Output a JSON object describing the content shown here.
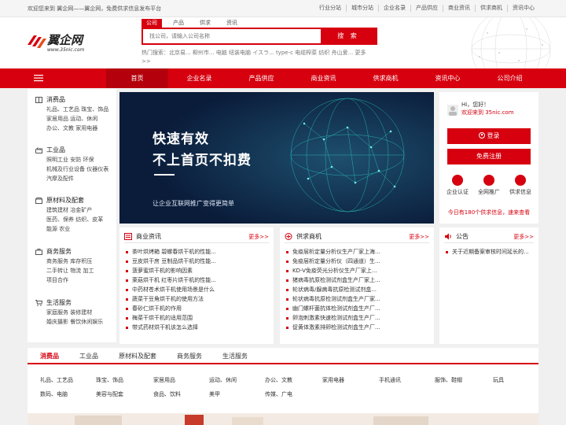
{
  "topbar": {
    "welcome": "欢迎您来到 翼企网——翼企网，免费供求信息发布平台",
    "links": [
      "行业分站",
      "城市分站",
      "企业名录",
      "产品供应",
      "商业资讯",
      "供求商机",
      "资讯中心"
    ]
  },
  "logo": {
    "name": "翼企网",
    "url": "www.35nic.com"
  },
  "search": {
    "tabs": [
      "公司",
      "产品",
      "供求",
      "资讯"
    ],
    "placeholder": "找公司，请输入公司名称",
    "button": "搜 索",
    "hot_label": "热门搜索：",
    "hot_text": "北京易...   柳州市...   电脑  纽装电脑  イスラ...   type-c 电缆榨菜  纺织  舟山爱...",
    "more": "更多>>"
  },
  "nav": {
    "menu_icon": "hamburger-icon",
    "items": [
      "首页",
      "企业名录",
      "产品供应",
      "商业资讯",
      "供求商机",
      "资讯中心",
      "公司介绍"
    ]
  },
  "categories": [
    {
      "title": "消费品",
      "icon": "book-icon",
      "lines": [
        "礼品、工艺品  珠宝、饰品",
        "家居用品  运动、休闲",
        "办公、文教  家用电器"
      ]
    },
    {
      "title": "工业品",
      "icon": "factory-icon",
      "lines": [
        "照明工业  安防  环保",
        "机械及行业设备  仪器仪表",
        "汽摩及配件"
      ]
    },
    {
      "title": "原材料及配套",
      "icon": "box-icon",
      "lines": [
        "建筑建材  冶金矿产",
        "医药、保养  纺织、皮革",
        "能源  农业"
      ]
    },
    {
      "title": "商务服务",
      "icon": "briefcase-icon",
      "lines": [
        "商务服务  库存积压",
        "二手转让  物流  加工",
        "项目合作"
      ]
    },
    {
      "title": "生活服务",
      "icon": "cart-icon",
      "lines": [
        "家庭服务  装修建材",
        "婚庆摄影  餐饮休闲娱乐"
      ]
    }
  ],
  "banner": {
    "line1": "快速有效",
    "line2": "不上首页不扣费",
    "line3": "让企业互联网推广变得更简单"
  },
  "user": {
    "greeting": "Hi，您好！",
    "welcome": "欢迎来到 35nic.com",
    "login": "登录",
    "register": "免费注册",
    "icons": [
      {
        "label": "企业认证",
        "icon": "certify-icon"
      },
      {
        "label": "全网推广",
        "icon": "promote-icon"
      },
      {
        "label": "供求信息",
        "icon": "info-icon"
      }
    ],
    "tip": "今日有180个供求信息，速来查看"
  },
  "news": {
    "title": "商业资讯",
    "more": "更多>>",
    "items": [
      "茶叶烘烤箱 碧螺春烘干机的性能...",
      "豆皮烘干房 豆制品烘干机的性能...",
      "菠萝蜜烘干机的影响因素",
      "萊菇烘干机 红枣片烘干机的性能...",
      "中药材苍术烘干机使用场景是什么",
      "蔬菜干豆角烘干机的使用方法",
      "春砂仁烘干机的作用",
      "梅菜干烘干机的适用范围",
      "带式药材烘干机该怎么选择"
    ]
  },
  "supply": {
    "title": "供求商机",
    "more": "更多>>",
    "items": [
      "免疫层析定量分析仪生产厂家上海...",
      "免疫层析定量分析仪（四通道）生...",
      "KD-V免疫荧光分析仪生产厂家上...",
      "猪病毒抗原检测试剂盒生产厂家上...",
      "轮状病毒/腺病毒抗原检测试剂盒...",
      "轮状病毒抗原检测试剂盒生产厂家...",
      "幽门螺杆菌抗体检测试剂盒生产厂...",
      "卵泡刺激素快速检测试剂盒生产厂...",
      "促黄体激素排卵检测试剂盒生产厂..."
    ]
  },
  "notice": {
    "title": "公告",
    "more": "更多>>",
    "items": [
      "关于近期备案审核时间延长的..."
    ]
  },
  "bottom": {
    "tabs": [
      "消费品",
      "工业品",
      "原材料及配套",
      "商务服务",
      "生活服务"
    ],
    "row1": [
      "礼品、工艺品",
      "珠宝、饰品",
      "家居用品",
      "运动、休闲",
      "办公、文教",
      "家用电器",
      "手机通讯",
      "服饰、鞋帽",
      "玩具"
    ],
    "row2": [
      "数码、电脑",
      "美容与配套",
      "食品、饮料",
      "美甲",
      "传媒、广电"
    ]
  }
}
